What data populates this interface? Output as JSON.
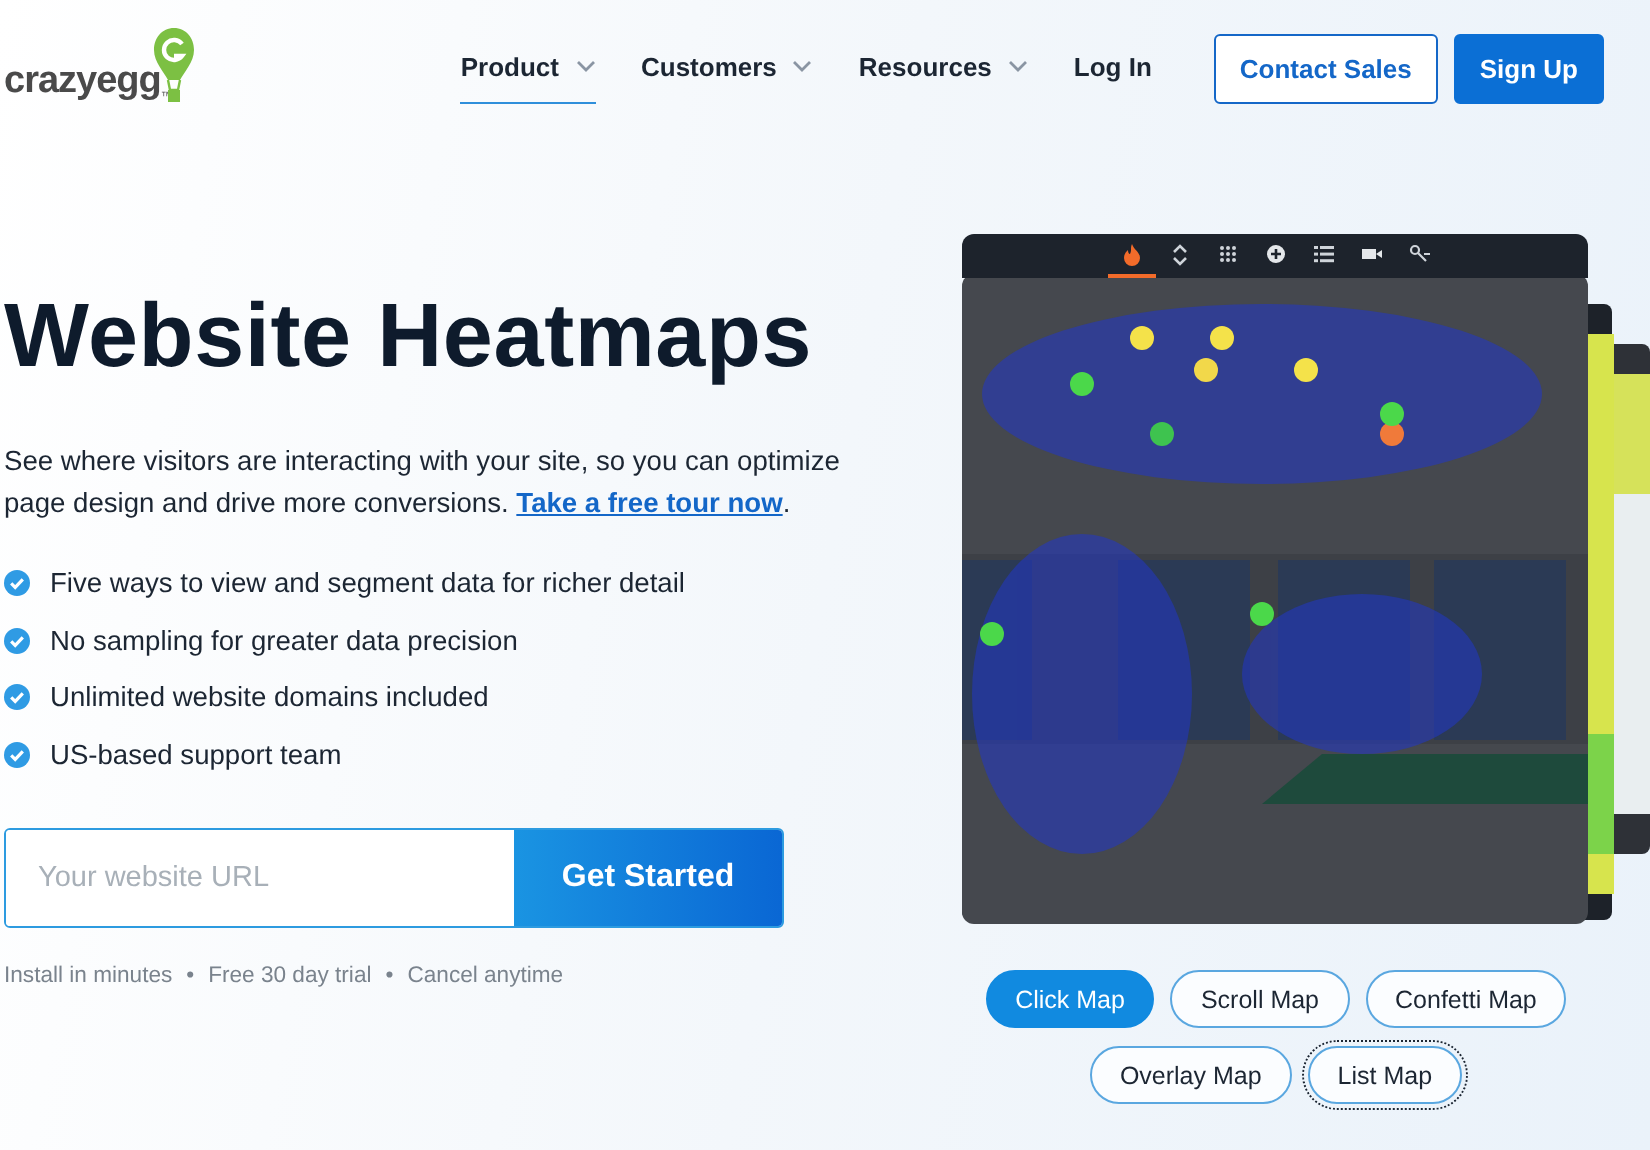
{
  "logo": {
    "name": "crazyegg",
    "trademark": "™"
  },
  "nav": {
    "items": [
      {
        "label": "Product",
        "has_menu": true,
        "selected": true
      },
      {
        "label": "Customers",
        "has_menu": true,
        "selected": false
      },
      {
        "label": "Resources",
        "has_menu": true,
        "selected": false
      },
      {
        "label": "Log In",
        "has_menu": false,
        "selected": false
      }
    ],
    "buttons": [
      {
        "label": "Contact Sales",
        "kind": "outline"
      },
      {
        "label": "Sign Up",
        "kind": "solid"
      }
    ]
  },
  "hero": {
    "title": "Website Heatmaps",
    "description": "See where visitors are interacting with your site, so you can optimize page design and drive more conversions.",
    "link": "Take a free tour now",
    "link_after": ".",
    "features": [
      "Five ways to view and segment data for richer detail",
      "No sampling for greater data precision",
      "Unlimited website domains included",
      "US-based support team"
    ],
    "url_field": {
      "placeholder": "Your website URL"
    },
    "cta": "Get Started",
    "notes": [
      "Install in minutes",
      "Free 30 day trial",
      "Cancel anytime"
    ],
    "separator": "•"
  },
  "preview": {
    "kind": "picture",
    "toolbar": [
      {
        "selected": true
      },
      {
        "selected": false
      },
      {
        "selected": false
      },
      {
        "selected": false
      },
      {
        "selected": false
      },
      {
        "selected": false
      },
      {
        "selected": false
      }
    ]
  },
  "map_types": [
    {
      "label": "Click Map",
      "selected": true,
      "focused": false
    },
    {
      "label": "Scroll Map",
      "selected": false,
      "focused": false
    },
    {
      "label": "Confetti Map",
      "selected": false,
      "focused": false
    },
    {
      "label": "Overlay Map",
      "selected": false,
      "focused": false
    },
    {
      "label": "List Map",
      "selected": false,
      "focused": true
    }
  ]
}
